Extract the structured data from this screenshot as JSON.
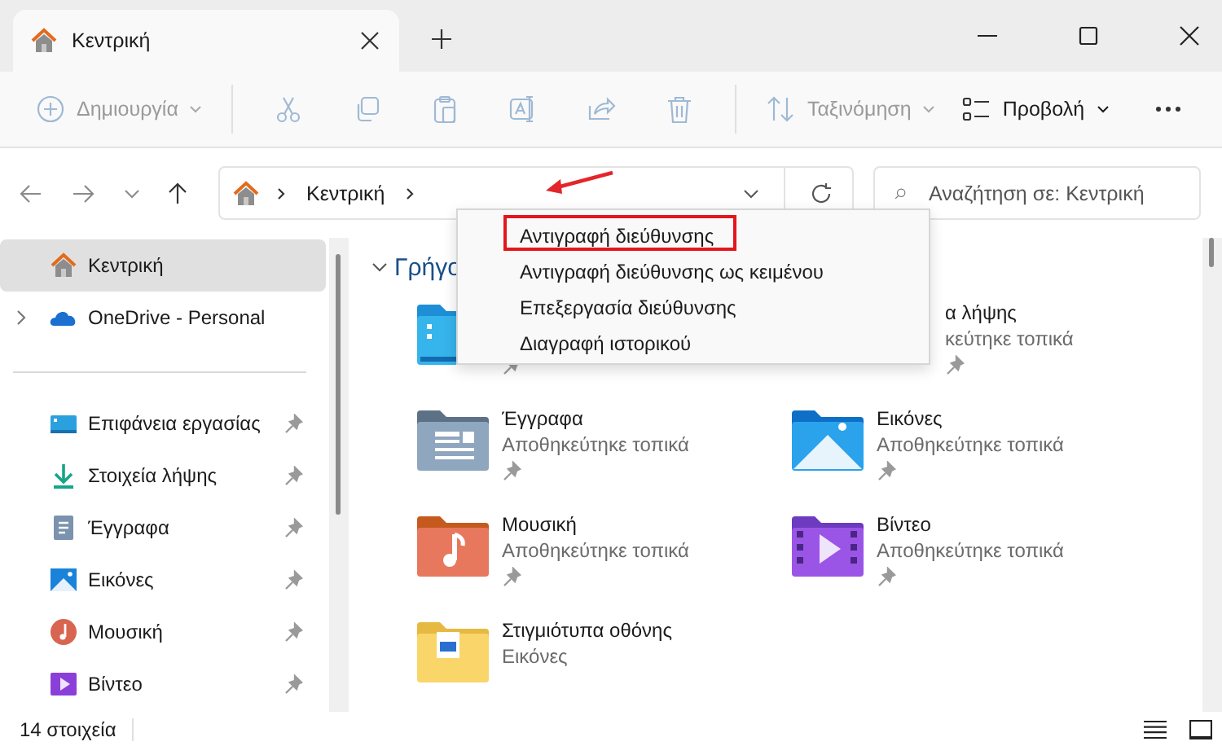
{
  "tabs": [
    {
      "label": "Κεντρική",
      "selected": true
    }
  ],
  "toolbar": {
    "items": [
      {
        "kind": "new",
        "label": "Δημιουργία",
        "disabled": true
      },
      {
        "kind": "cut",
        "disabled": true
      },
      {
        "kind": "copy",
        "disabled": true
      },
      {
        "kind": "paste",
        "disabled": true
      },
      {
        "kind": "rename",
        "disabled": true
      },
      {
        "kind": "share",
        "disabled": true
      },
      {
        "kind": "delete",
        "disabled": true
      },
      {
        "kind": "sort",
        "label": "Ταξινόμηση",
        "disabled": true
      },
      {
        "kind": "view",
        "label": "Προβολή",
        "disabled": false
      },
      {
        "kind": "more",
        "disabled": false
      }
    ]
  },
  "address_bar": {
    "segments": [
      "Κεντρική"
    ]
  },
  "search": {
    "placeholder": "Αναζήτηση σε: Κεντρική"
  },
  "sidebar": {
    "top": [
      {
        "kind": "home",
        "label": "Κεντρική",
        "selected": true,
        "has_children": false
      },
      {
        "kind": "cloud",
        "label": "OneDrive - Personal",
        "selected": false,
        "has_children": true
      }
    ],
    "pinned": [
      {
        "kind": "desktop",
        "label": "Επιφάνεια εργασίας",
        "selected": false,
        "pinned": true
      },
      {
        "kind": "downloads",
        "label": "Στοιχεία λήψης",
        "selected": false,
        "pinned": true
      },
      {
        "kind": "documents",
        "label": "Έγγραφα",
        "selected": false,
        "pinned": true
      },
      {
        "kind": "pictures",
        "label": "Εικόνες",
        "selected": false,
        "pinned": true
      },
      {
        "kind": "music",
        "label": "Μουσική",
        "selected": false,
        "pinned": true
      },
      {
        "kind": "videos",
        "label": "Βίντεο",
        "selected": false,
        "pinned": true
      }
    ]
  },
  "section": {
    "title": "Γρήγο",
    "expanded": true,
    "items": [
      {
        "kind": "desktop",
        "pinned": true
      },
      {
        "kind": "downloads",
        "name": "α λήψης",
        "subtitle": "κεύτηκε τοπικά",
        "pinned": true
      },
      {
        "kind": "documents",
        "name": "Έγγραφα",
        "subtitle": "Αποθηκεύτηκε τοπικά",
        "pinned": true
      },
      {
        "kind": "pictures",
        "name": "Εικόνες",
        "subtitle": "Αποθηκεύτηκε τοπικά",
        "pinned": true
      },
      {
        "kind": "music",
        "name": "Μουσική",
        "subtitle": "Αποθηκεύτηκε τοπικά",
        "pinned": true
      },
      {
        "kind": "videos",
        "name": "Βίντεο",
        "subtitle": "Αποθηκεύτηκε τοπικά",
        "pinned": true
      },
      {
        "kind": "screenshots",
        "name": "Στιγμιότυπα οθόνης",
        "subtitle": "Εικόνες",
        "pinned": false
      }
    ]
  },
  "context_menu": {
    "items": [
      {
        "label": "Αντιγραφή διεύθυνσης",
        "highlighted": true
      },
      {
        "label": "Αντιγραφή διεύθυνσης ως κειμένου",
        "highlighted": false
      },
      {
        "label": "Επεξεργασία διεύθυνσης",
        "highlighted": false
      },
      {
        "label": "Διαγραφή ιστορικού",
        "highlighted": false
      }
    ]
  },
  "status_bar": {
    "count": "14 στοιχεία"
  }
}
